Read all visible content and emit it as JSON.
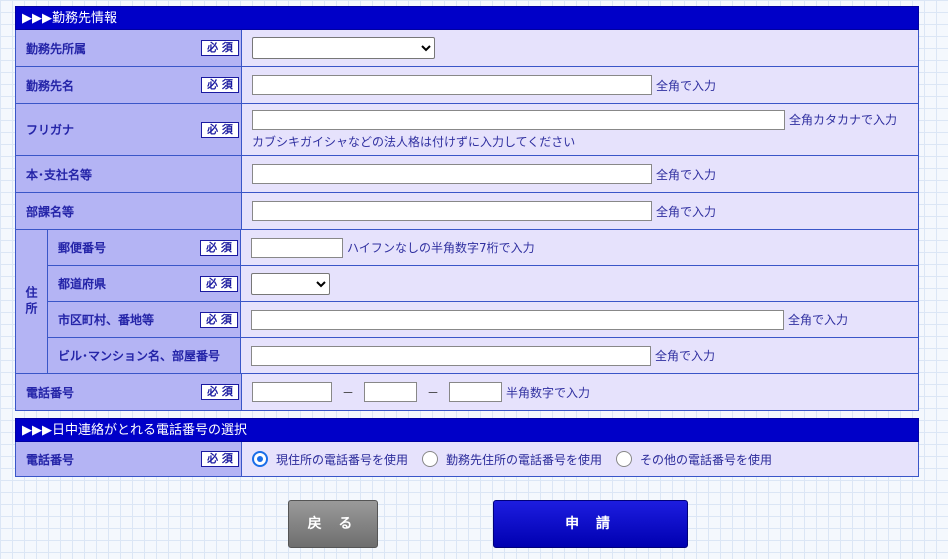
{
  "work_section": {
    "title": "▶▶▶勤務先情報",
    "required_label": "必 須",
    "affiliation": {
      "label": "勤務先所属",
      "selected": ""
    },
    "company_name": {
      "label": "勤務先名",
      "value": "",
      "hint": "全角で入力"
    },
    "furigana": {
      "label": "フリガナ",
      "value": "",
      "hint": "全角カタカナで入力",
      "note": "カブシキガイシャなどの法人格は付けずに入力してください"
    },
    "branch_name": {
      "label": "本･支社名等",
      "value": "",
      "hint": "全角で入力"
    },
    "department": {
      "label": "部課名等",
      "value": "",
      "hint": "全角で入力"
    },
    "address": {
      "side_label": "住所",
      "postal": {
        "label": "郵便番号",
        "value": "",
        "hint": "ハイフンなしの半角数字7桁で入力"
      },
      "prefecture": {
        "label": "都道府県",
        "selected": ""
      },
      "city": {
        "label": "市区町村、番地等",
        "value": "",
        "hint": "全角で入力"
      },
      "building": {
        "label": "ビル･マンション名、部屋番号",
        "value": "",
        "hint": "全角で入力"
      }
    },
    "phone": {
      "label": "電話番号",
      "part1": "",
      "part2": "",
      "part3": "",
      "separator": "－",
      "hint": "半角数字で入力"
    }
  },
  "daytime_section": {
    "title": "▶▶▶日中連絡がとれる電話番号の選択",
    "label": "電話番号",
    "required_label": "必 須",
    "options": [
      {
        "label": "現住所の電話番号を使用",
        "checked": true
      },
      {
        "label": "勤務先住所の電話番号を使用",
        "checked": false
      },
      {
        "label": "その他の電話番号を使用",
        "checked": false
      }
    ]
  },
  "buttons": {
    "back": "戻 る",
    "apply": "申 請"
  }
}
